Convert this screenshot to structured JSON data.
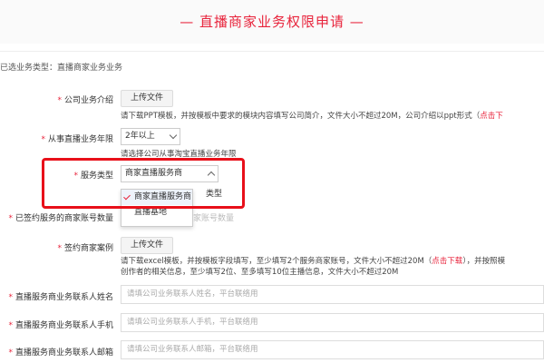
{
  "header": {
    "title": "—  直播商家业务权限申请  —"
  },
  "selected_type": "已选业务类型：直播商家业务业务",
  "company_intro": {
    "label": "公司业务介绍",
    "button": "上传文件",
    "hint_prefix": "请下载PPT模板，并按模板中要求的模块内容填写公司简介，文件大小不超过20M，公司介绍以ppt形式（",
    "hint_link": "点击下"
  },
  "years": {
    "label": "从事直播业务年限",
    "value": "2年以上",
    "hint": "请选择公司从事淘宝直播业务年限"
  },
  "service_type": {
    "label": "服务类型",
    "value": "商家直播服务商",
    "options": [
      "商家直播服务商",
      "直播基地"
    ],
    "behind_text": "类型"
  },
  "signed_accounts": {
    "label": "已签约服务的商家账号数量",
    "placeholder": "家账号数量"
  },
  "cases": {
    "label": "签约商家案例",
    "button": "上传文件",
    "hint_line1_a": "请下载excel模板，并按模板字段填写，至少填写2个服务商家账号，文件大小不超过20M（",
    "hint_line1_link": "点击下载",
    "hint_line1_b": "），并按照模",
    "hint_line2": "创作者的相关信息，至少填写2位、至多填写10位主播信息，文件大小不超过20M"
  },
  "contact_name": {
    "label": "直播服务商业务联系人姓名",
    "placeholder": "请填公司业务联系人姓名，平台联络用"
  },
  "contact_phone": {
    "label": "直播服务商业务联系人手机",
    "placeholder": "请填公司业务联系人手机，平台联络用"
  },
  "contact_email": {
    "label": "直播服务商业务联系人邮箱",
    "placeholder": "请填公司业务联系人邮箱，平台联络用"
  },
  "colors": {
    "accent": "#e8243c",
    "highlight": "#e8101a"
  }
}
